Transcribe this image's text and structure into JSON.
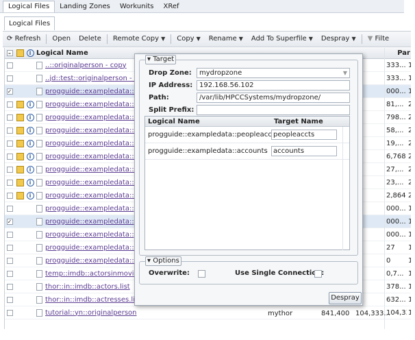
{
  "top_tabs": [
    "Logical Files",
    "Landing Zones",
    "Workunits",
    "XRef"
  ],
  "sub_tab": "Logical Files",
  "toolbar": {
    "refresh": "Refresh",
    "open": "Open",
    "delete": "Delete",
    "remote_copy": "Remote Copy",
    "copy": "Copy",
    "rename": "Rename",
    "add_to_superfile": "Add To Superfile",
    "despray": "Despray",
    "filter": "Filte"
  },
  "grid": {
    "header_name": "Logical Name",
    "header_right": "Par",
    "rows": [
      {
        "name": "..::originalperson - copy",
        "checked": false,
        "icons": false,
        "right": "333...",
        "part": "1"
      },
      {
        "name": "..jd::test::originalperson - co",
        "checked": false,
        "icons": false,
        "right": "333...",
        "part": "1"
      },
      {
        "name": "progguide::exampledata::a",
        "checked": true,
        "icons": false,
        "right": "000...",
        "part": "1",
        "selected": true
      },
      {
        "name": "progguide::exampledata::k",
        "checked": false,
        "icons": true,
        "right": "81,...",
        "part": "2"
      },
      {
        "name": "progguide::exampledata::k",
        "checked": false,
        "icons": true,
        "right": "798...",
        "part": "2"
      },
      {
        "name": "progguide::exampledata::k",
        "checked": false,
        "icons": true,
        "right": "58,...",
        "part": "2"
      },
      {
        "name": "progguide::exampledata::k",
        "checked": false,
        "icons": true,
        "right": "19,...",
        "part": "2"
      },
      {
        "name": "progguide::exampledata::k",
        "checked": false,
        "icons": true,
        "right": "6,768",
        "part": "2"
      },
      {
        "name": "progguide::exampledata::k",
        "checked": false,
        "icons": true,
        "right": "27,...",
        "part": "2"
      },
      {
        "name": "progguide::exampledata::k",
        "checked": false,
        "icons": true,
        "right": "23,...",
        "part": "2"
      },
      {
        "name": "progguide::exampledata::k",
        "checked": false,
        "icons": true,
        "right": "2,864",
        "part": "2"
      },
      {
        "name": "progguide::exampledata::p",
        "checked": false,
        "icons": false,
        "right": "000...",
        "part": "1"
      },
      {
        "name": "progguide::exampledata::p",
        "checked": true,
        "icons": false,
        "right": "000...",
        "part": "1",
        "selected": true
      },
      {
        "name": "progguide::exampledata::p",
        "checked": false,
        "icons": false,
        "right": "000...",
        "part": "1"
      },
      {
        "name": "progguide::exampledata::x",
        "checked": false,
        "icons": false,
        "right": "27",
        "part": "1"
      },
      {
        "name": "progguide::exampledata::x",
        "checked": false,
        "icons": false,
        "right": "0",
        "part": "1"
      },
      {
        "name": "temp::imdb::actorsinmovie",
        "checked": false,
        "icons": false,
        "right": "0,7...",
        "part": "1"
      },
      {
        "name": "thor::in::imdb::actors.list",
        "checked": false,
        "icons": false,
        "right": "378...",
        "part": "1"
      },
      {
        "name": "thor::in::imdb::actresses.lis",
        "checked": false,
        "icons": false,
        "right": "632...",
        "part": "1"
      },
      {
        "name": "tutorial::yn::originalperson",
        "checked": false,
        "icons": false,
        "right": "104,333...",
        "part": "1",
        "owner": "mythor",
        "size": "841,400"
      }
    ]
  },
  "dialog": {
    "target_legend": "Target",
    "drop_zone_label": "Drop Zone:",
    "drop_zone_value": "mydropzone",
    "ip_label": "IP Address:",
    "ip_value": "192.168.56.102",
    "path_label": "Path:",
    "path_value": "/var/lib/HPCCSystems/mydropzone/",
    "split_label": "Split Prefix:",
    "split_value": "",
    "col_logical": "Logical Name",
    "col_target": "Target Name",
    "targets": [
      {
        "logical": "progguide::exampledata::peopleaccts",
        "target": "peopleaccts"
      },
      {
        "logical": "progguide::exampledata::accounts",
        "target": "accounts"
      }
    ],
    "options_legend": "Options",
    "overwrite_label": "Overwrite:",
    "single_conn_label": "Use Single Connection:",
    "despray_button": "Despray"
  }
}
